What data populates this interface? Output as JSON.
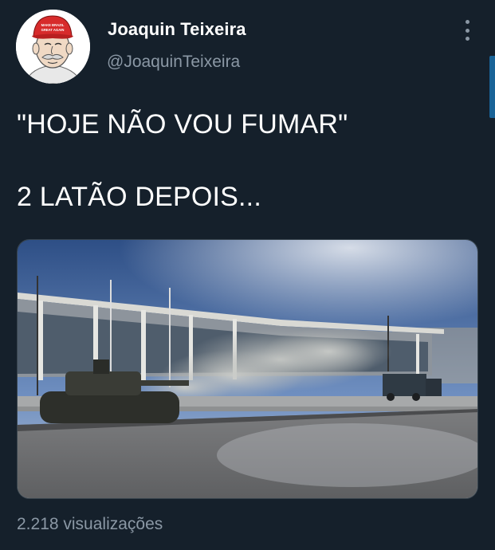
{
  "tweet": {
    "author_name": "Joaquin Teixeira",
    "author_handle": "@JoaquinTeixeira",
    "avatar_cap_text": "MAKE BRAZIL GREAT AGAIN",
    "text_line1": "\"HOJE NÃO VOU FUMAR\"",
    "text_line2": "2 LATÃO DEPOIS...",
    "views": "2.218 visualizações"
  },
  "icons": {
    "more": "more-vertical-icon"
  },
  "colors": {
    "background": "#15202b",
    "text_primary": "#ffffff",
    "text_secondary": "#8b98a5",
    "accent": "#1d9bf0"
  }
}
